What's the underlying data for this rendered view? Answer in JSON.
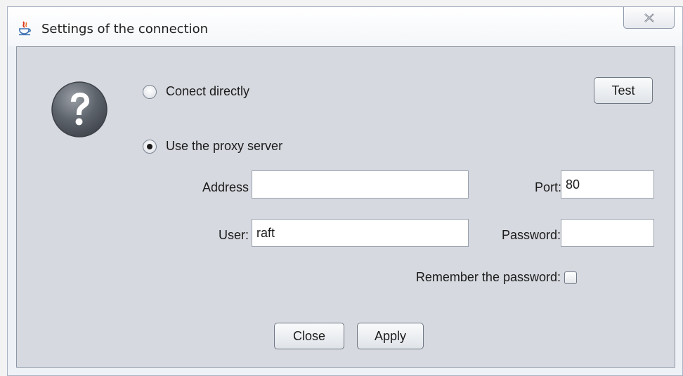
{
  "window": {
    "title": "Settings of the connection",
    "close_icon": "close-icon"
  },
  "dialog": {
    "help_icon": "question-mark-icon",
    "connect_directly_label": "Conect directly",
    "connect_directly_checked": false,
    "use_proxy_label": "Use the proxy server",
    "use_proxy_checked": true,
    "test_button": "Test",
    "address_label": "Address",
    "address_value": "",
    "port_label": "Port:",
    "port_value": "80",
    "user_label": "User:",
    "user_value": "raft",
    "password_label": "Password:",
    "password_value": "",
    "remember_label": "Remember the password:",
    "remember_checked": false,
    "close_button": "Close",
    "apply_button": "Apply"
  }
}
